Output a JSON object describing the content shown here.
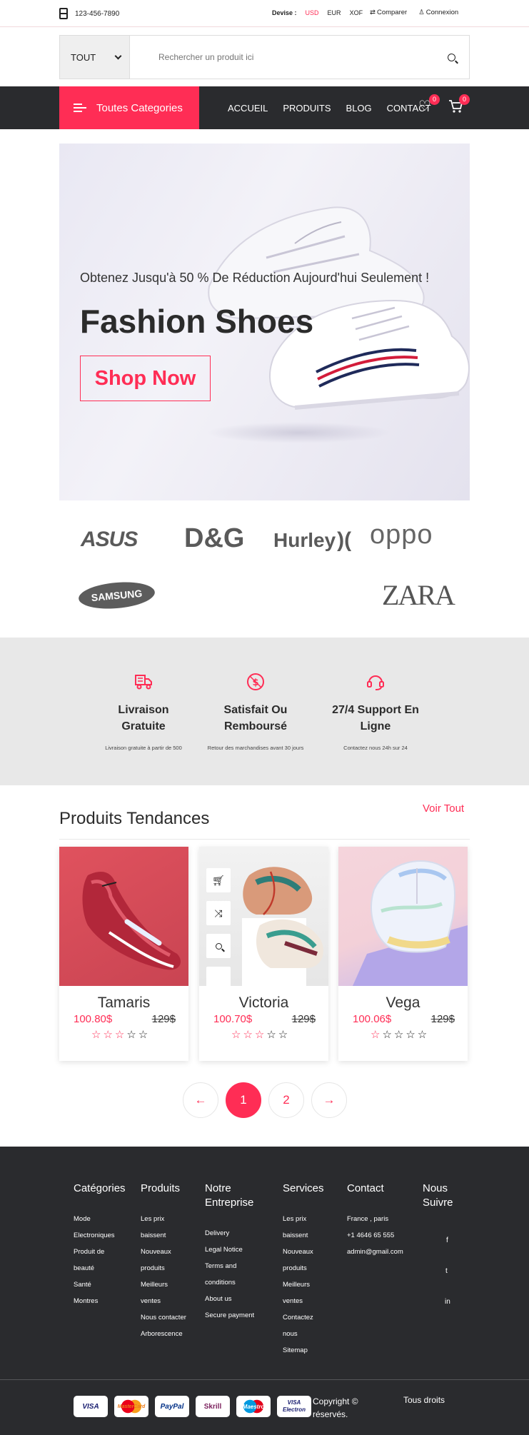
{
  "topbar": {
    "phone": "123-456-7890",
    "currency_label": "Devise :",
    "currencies": [
      "USD",
      "EUR",
      "XOF"
    ],
    "compare": "Comparer",
    "login": "Connexion"
  },
  "search": {
    "category": "TOUT",
    "placeholder": "Rechercher un produit ici"
  },
  "nav": {
    "categories_button": "Toutes Categories",
    "menu": [
      "ACCUEIL",
      "PRODUITS",
      "BLOG",
      "CONTACT"
    ],
    "wishlist_count": "0",
    "cart_count": "0"
  },
  "hero": {
    "promo": "Obtenez Jusqu'à 50 % De Réduction Aujourd'hui Seulement !",
    "title": "Fashion Shoes",
    "cta": "Shop Now"
  },
  "brands": [
    "ASUS",
    "D&G",
    "Hurley",
    "oppo",
    "SAMSUNG",
    "ZARA"
  ],
  "features": [
    {
      "icon": "delivery-truck-icon",
      "title_line1": "Livraison",
      "title_line2": "Gratuite",
      "subtitle": "Livraison gratuite à partir de 500"
    },
    {
      "icon": "money-back-icon",
      "title_line1": "Satisfait Ou",
      "title_line2": "Remboursé",
      "subtitle": "Retour des marchandises avant 30 jours"
    },
    {
      "icon": "headset-support-icon",
      "title_line1": "27/4 Support En",
      "title_line2": "Ligne",
      "subtitle": "Contactez nous 24h sur 24"
    }
  ],
  "trending": {
    "title": "Produits Tendances",
    "see_all": "Voir Tout",
    "products": [
      {
        "name": "Tamaris",
        "price": "100.80$",
        "old_price": "129$",
        "rating": 3
      },
      {
        "name": "Victoria",
        "price": "100.70$",
        "old_price": "129$",
        "rating": 3
      },
      {
        "name": "Vega",
        "price": "100.06$",
        "old_price": "129$",
        "rating": 1
      }
    ]
  },
  "pagination": {
    "prev": "←",
    "pages": [
      "1",
      "2"
    ],
    "current": "1",
    "next": "→"
  },
  "footer": {
    "columns": [
      {
        "title_line1": "Catégories",
        "title_line2": "",
        "items": [
          "Mode",
          "Electroniques",
          "Produit de",
          "beauté",
          "Santé",
          "Montres"
        ]
      },
      {
        "title_line1": "Produits",
        "title_line2": "",
        "items": [
          "Les prix",
          "baissent",
          "Nouveaux",
          "produits",
          "Meilleurs",
          "ventes",
          "Nous contacter",
          "Arborescence"
        ]
      },
      {
        "title_line1": "Notre",
        "title_line2": "Entreprise",
        "items": [
          "Delivery",
          "Legal Notice",
          "Terms and",
          "conditions",
          "About us",
          "Secure payment"
        ]
      },
      {
        "title_line1": "Services",
        "title_line2": "",
        "items": [
          "Les prix",
          "baissent",
          "Nouveaux",
          "produits",
          "Meilleurs",
          "ventes",
          "Contactez",
          "nous",
          "Sitemap"
        ]
      },
      {
        "title_line1": "Contact",
        "title_line2": "",
        "items": [
          "France , paris",
          "+1 4646 65 555",
          "admin@gmail.com"
        ]
      },
      {
        "title_line1": "Nous",
        "title_line2": "Suivre",
        "items": []
      }
    ],
    "social": [
      "f",
      "t",
      "in"
    ],
    "payments": [
      "VISA",
      "MasterCard",
      "PayPal",
      "Skrill",
      "Maestro",
      "VISA Electron"
    ],
    "copyright_line1": "Copyright ©",
    "copyright_line2": "réservés.",
    "rights": "Tous droits"
  },
  "colors": {
    "accent": "#ff2d55",
    "dark": "#2a2b2e",
    "feature_bg": "#e8e8e8"
  }
}
